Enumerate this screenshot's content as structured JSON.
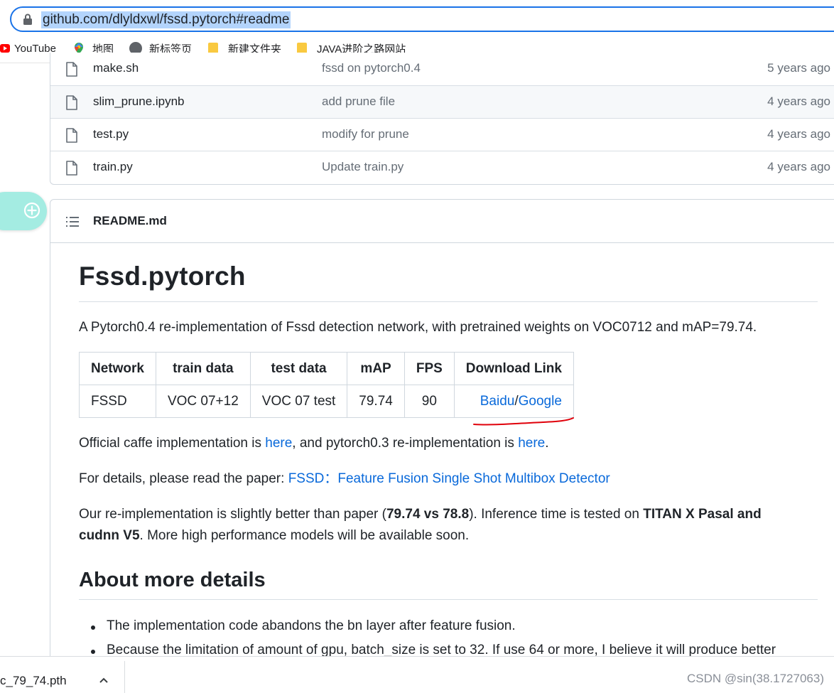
{
  "browser": {
    "url": "github.com/dlyldxwl/fssd.pytorch#readme",
    "bookmarks": [
      {
        "label": "YouTube",
        "icon": "youtube-icon"
      },
      {
        "label": "地图",
        "icon": "maps-icon"
      },
      {
        "label": "新标签页",
        "icon": "globe-icon"
      },
      {
        "label": "新建文件夹",
        "icon": "folder-icon"
      },
      {
        "label": "JAVA进阶之路网站",
        "icon": "folder-icon"
      }
    ]
  },
  "files": [
    {
      "name": "make.sh",
      "message": "fssd on pytorch0.4",
      "age": "5 years ago"
    },
    {
      "name": "slim_prune.ipynb",
      "message": "add prune file",
      "age": "4 years ago"
    },
    {
      "name": "test.py",
      "message": "modify for prune",
      "age": "4 years ago"
    },
    {
      "name": "train.py",
      "message": "Update train.py",
      "age": "4 years ago"
    }
  ],
  "readme": {
    "file_title": "README.md",
    "title": "Fssd.pytorch",
    "intro": "A Pytorch0.4 re-implementation of Fssd detection network, with pretrained weights on VOC0712 and mAP=79.74.",
    "table": {
      "headers": [
        "Network",
        "train data",
        "test data",
        "mAP",
        "FPS",
        "Download Link"
      ],
      "row": {
        "network": "FSSD",
        "train": "VOC 07+12",
        "test": "VOC 07 test",
        "map": "79.74",
        "fps": "90",
        "link_a": "Baidu",
        "link_sep": "/",
        "link_b": "Google"
      }
    },
    "official": {
      "pre": "Official caffe implementation is ",
      "link1": "here",
      "mid": ", and pytorch0.3 re-implementation is ",
      "link2": "here",
      "post": "."
    },
    "details": {
      "pre": "For details, please read the paper: ",
      "link": "FSSD：Feature Fusion Single Shot Multibox Detector"
    },
    "ours": {
      "pre": "Our re-implementation is slightly better than paper (",
      "bold1": "79.74 vs 78.8",
      "mid": "). Inference time is tested on ",
      "bold2": "TITAN X Pasal and",
      "bold3": "cudnn V5",
      "post": ". More high performance models will be available soon."
    },
    "section_title": "About more details",
    "bullets": [
      "The implementation code abandons the bn layer after feature fusion.",
      "Because the limitation of amount of gpu, batch_size is set to 32. If use 64 or more, I believe it will produce better"
    ]
  },
  "download_bar": {
    "file": "c_79_74.pth"
  },
  "watermark": "CSDN @sin(38.1727063)",
  "colors": {
    "link": "#0969da",
    "url_highlight": "#b3d4fc",
    "focus": "#1a73e8",
    "annotation": "#e0000a"
  }
}
